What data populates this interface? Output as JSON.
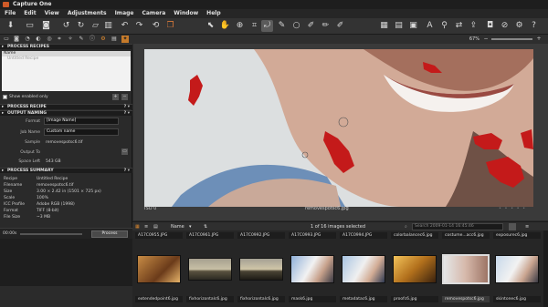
{
  "window": {
    "title": "Capture One"
  },
  "menu": [
    "File",
    "Edit",
    "View",
    "Adjustments",
    "Image",
    "Camera",
    "Window",
    "Help"
  ],
  "toolbar": {
    "zoom": "67%"
  },
  "left_panel": {
    "process_recipes_header": "PROCESS RECIPES",
    "name_col": "Name",
    "recipe_item": "Untitled Recipe",
    "show_enabled": "Show enabled only",
    "process_recipe_header": "PROCESS RECIPE",
    "output_naming_header": "OUTPUT NAMING",
    "format_label": "Format",
    "format_value": "[Image Name]",
    "job_name_label": "Job Name",
    "job_name_value": "Custom name",
    "sample_label": "Sample",
    "sample_value": "removespotsc6.tif",
    "output_to_label": "Output To",
    "space_left_label": "Space Left",
    "space_left_value": "543 GB",
    "process_summary_header": "PROCESS SUMMARY",
    "summary": [
      {
        "k": "Recipe",
        "v": "Untitled Recipe"
      },
      {
        "k": "Filename",
        "v": "removespotsc6.tif"
      },
      {
        "k": "Size",
        "v": "3.00 × 2.42 in (1501 × 725 px)"
      },
      {
        "k": "Scale",
        "v": "100%"
      },
      {
        "k": "ICC Profile",
        "v": "Adobe RGB (1998)"
      },
      {
        "k": "Format",
        "v": "TIFF (8-bit)"
      },
      {
        "k": "File Size",
        "v": "~3 MB"
      }
    ],
    "time": "00:00s",
    "process_button": "Process"
  },
  "viewer": {
    "iso": "ISO 0",
    "filename": "removespotsc6.jpg"
  },
  "browser": {
    "sort_label": "Name",
    "selection": "1 of 16 images selected",
    "search_placeholder": "Search 2009-01-14 16:45:46"
  },
  "filmstrip": {
    "top_labels": [
      "A17C0955.JPG",
      "A17C0961.JPG",
      "A17C0992.JPG",
      "A17C0993.JPG",
      "A17C0994.JPG",
      "colorbalancec6.jpg",
      "costume...acc6.jpg",
      "exposurec6.jpg"
    ],
    "bottom_labels": [
      "extendedpoint6.jpg",
      "fixhorizontalc6.jpg",
      "fixhorizontalc6.jpg",
      "mask6.jpg",
      "metadatac6.jpg",
      "proofc6.jpg",
      "removespotsc6.jpg",
      "skintonec6.jpg"
    ]
  }
}
